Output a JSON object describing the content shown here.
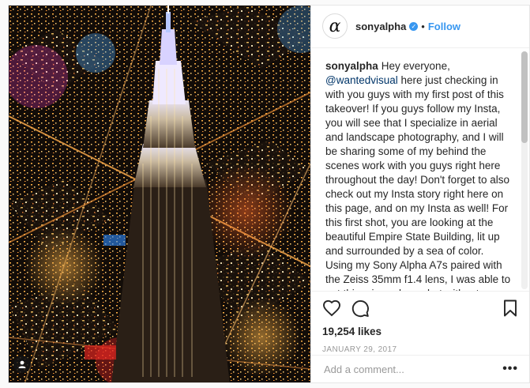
{
  "post": {
    "username": "sonyalpha",
    "follow_label": "Follow",
    "dot": "•",
    "avatar_glyph": "α",
    "verified_glyph": "✓",
    "caption": {
      "username": "sonyalpha",
      "before_mention": "Hey everyone,",
      "mention": "@wantedvisual",
      "after_mention": " here just checking in with you guys with my first post of this takeover! If you guys follow my Insta, you will see that I specialize in aerial and landscape photography, and I will be sharing some of my behind the scenes work with you guys right here throughout the day! Don't forget to also check out my Insta story right here on this page, and on my Insta as well! For this first shot, you are looking at the beautiful Empire State Building, lit up and surrounded by a sea of color. Using my Sony Alpha A7s paired with the Zeiss 35mm f1.4 lens, I was able to get this crispy clean shot without worrying about taking my ISO a few notches up. Pairing the low light capability of the A7S with a fast prime is a great combination for when you want to shoot"
    },
    "likes": "19,254 likes",
    "date": "JANUARY 29, 2017",
    "comment_placeholder": "Add a comment...",
    "more_label": "•••",
    "icons": {
      "like": "heart-icon",
      "comment": "comment-icon",
      "save": "bookmark-icon",
      "tag": "person-tag-icon"
    },
    "colors": {
      "link": "#3897f0",
      "mention": "#003569",
      "muted": "#999999"
    }
  }
}
